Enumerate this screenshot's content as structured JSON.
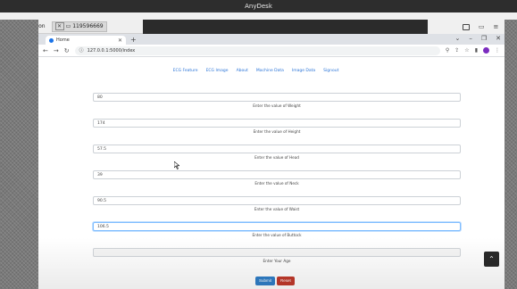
{
  "anydesk": {
    "title": "AnyDesk",
    "session_label": "New Session",
    "remote_id": "119596669"
  },
  "browser": {
    "tab_title": "Home",
    "url": "127.0.0.1:5000/index"
  },
  "nav": {
    "links": [
      "ECG Feature",
      "ECG Image",
      "About",
      "Machine Data",
      "Image Data",
      "Signout"
    ]
  },
  "form": {
    "fields": [
      {
        "value": "80",
        "caption": "Enter the value of Weight"
      },
      {
        "value": "174",
        "caption": "Enter the value of Height"
      },
      {
        "value": "57.5",
        "caption": "Enter the value of Head"
      },
      {
        "value": "39",
        "caption": "Enter the value of Neck"
      },
      {
        "value": "90.5",
        "caption": "Enter the value of Waist"
      },
      {
        "value": "106.5",
        "caption": "Enter the value of Buttock"
      },
      {
        "value": "",
        "caption": "Enter Your Age"
      }
    ],
    "submit_label": "Submit",
    "reset_label": "Reset"
  },
  "icons": {
    "scroll_top": "chevron-up-icon"
  },
  "colors": {
    "nav_link": "#2a74d8",
    "submit": "#2f7ec7",
    "reset": "#c0392b"
  }
}
